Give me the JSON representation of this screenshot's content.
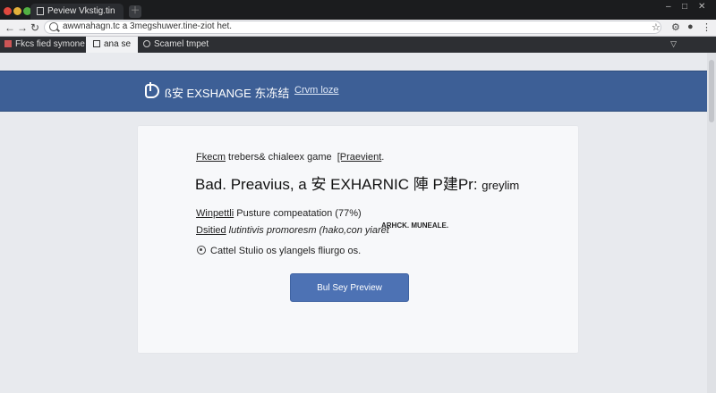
{
  "browser": {
    "tab_title": "Peview Vkstig.tin",
    "url": "awwnahagn.tc a 3megshuwer.tine-ziot het.",
    "bookmarks": [
      {
        "label": "Fkcs fied symone"
      },
      {
        "label": "ana se"
      },
      {
        "label": "Scamel tmpet"
      }
    ]
  },
  "banner": {
    "brand": "ß安 EXSHANGE 东冻结",
    "link": "Crvm loze"
  },
  "card": {
    "subtitle_underlined": "Fkecm",
    "subtitle_rest": " trebers& chialeex game",
    "subtitle_underlined_2": "[Praevient",
    "subtitle_tail": ".",
    "title": "Bad. Preavius, a 安 EXHARNIC 陣 P建Pr:",
    "title_tail": "greylim",
    "line1_underlined": "Winpettli",
    "line1_rest": " Pusture compeatation (77%)",
    "line2_underlined": "Dsitied",
    "line2_rest": " lutintivis promoresm (hako,con yiaret",
    "tag": "ARHCK. MUNEALE.",
    "info": "Cattel Stulio os ylangels fliurgo os.",
    "button": "Bul Sey Preview"
  },
  "colors": {
    "banner": "#3d5f96",
    "button": "#4d72b4",
    "page": "#e8eaee",
    "card": "#f7f8fa"
  }
}
